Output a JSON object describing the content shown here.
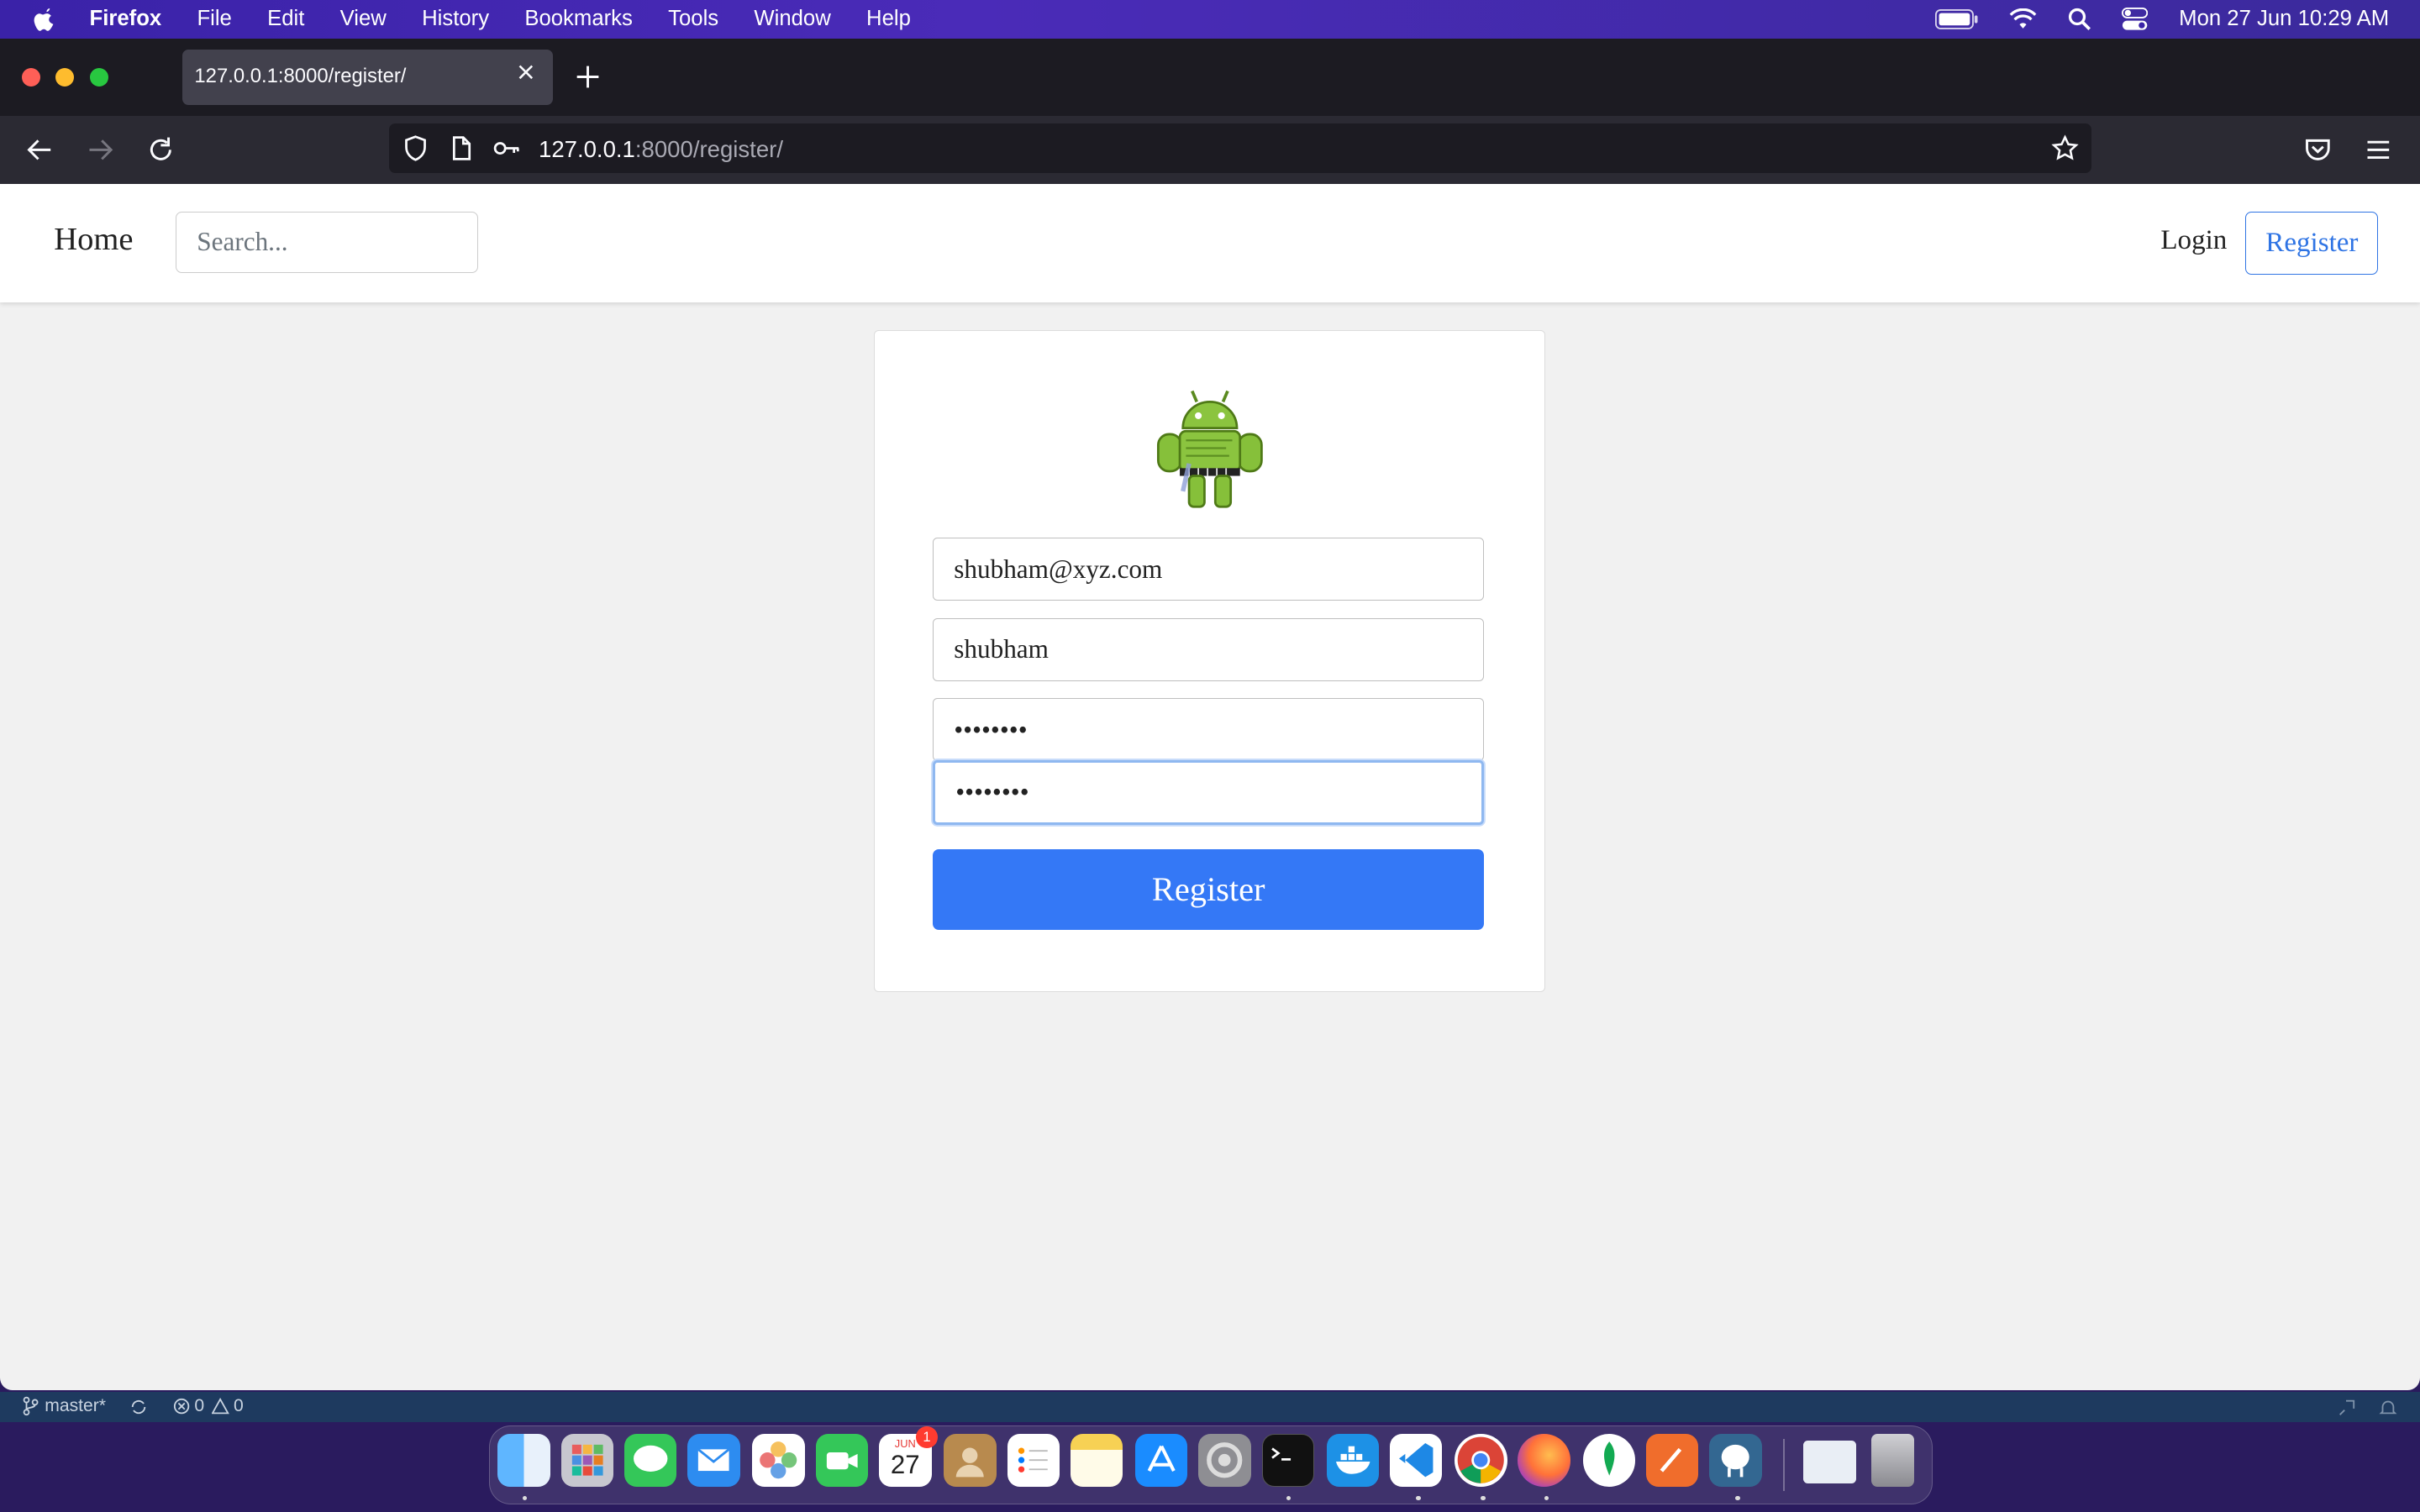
{
  "menubar": {
    "app": "Firefox",
    "items": [
      "File",
      "Edit",
      "View",
      "History",
      "Bookmarks",
      "Tools",
      "Window",
      "Help"
    ],
    "clock": "Mon 27 Jun  10:29 AM"
  },
  "browser": {
    "tab_title": "127.0.0.1:8000/register/",
    "url_host": "127.0.0.1",
    "url_rest": ":8000/register/"
  },
  "site": {
    "brand": "Home",
    "search_placeholder": "Search...",
    "login_label": "Login",
    "register_nav_label": "Register"
  },
  "form": {
    "email_value": "shubham@xyz.com",
    "username_value": "shubham",
    "password_value": "••••••••",
    "confirm_value": "••••••••",
    "submit_label": "Register"
  },
  "statusbar": {
    "branch": "master*",
    "errors": "0",
    "warnings": "0"
  },
  "dock": {
    "calendar_month": "JUN",
    "calendar_day": "27",
    "calendar_badge": "1"
  }
}
